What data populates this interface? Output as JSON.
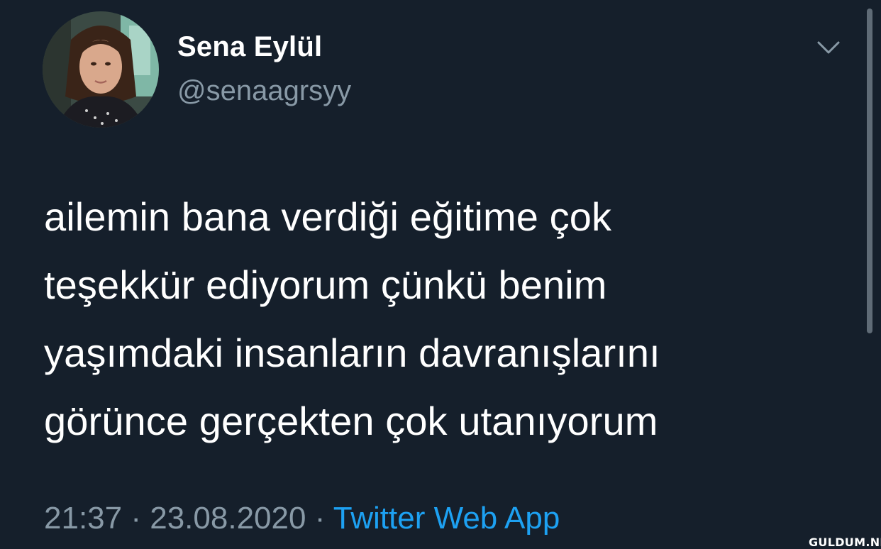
{
  "tweet": {
    "author": {
      "display_name": "Sena Eylül",
      "handle": "@senaagrsyy",
      "avatar_icon": "profile-photo"
    },
    "menu_icon": "chevron-down-icon",
    "text_lines": [
      "ailemin bana verdiği eğitime çok",
      "teşekkür ediyorum çünkü benim",
      "yaşımdaki insanların davranışlarını",
      "görünce gerçekten çok utanıyorum"
    ],
    "time": "21:37",
    "separator": "·",
    "date": "23.08.2020",
    "source": "Twitter Web App"
  },
  "watermark": "GULDUM.NET",
  "colors": {
    "background": "#151f2b",
    "text": "#ffffff",
    "secondary": "#8899a6",
    "link": "#1da1f2"
  }
}
